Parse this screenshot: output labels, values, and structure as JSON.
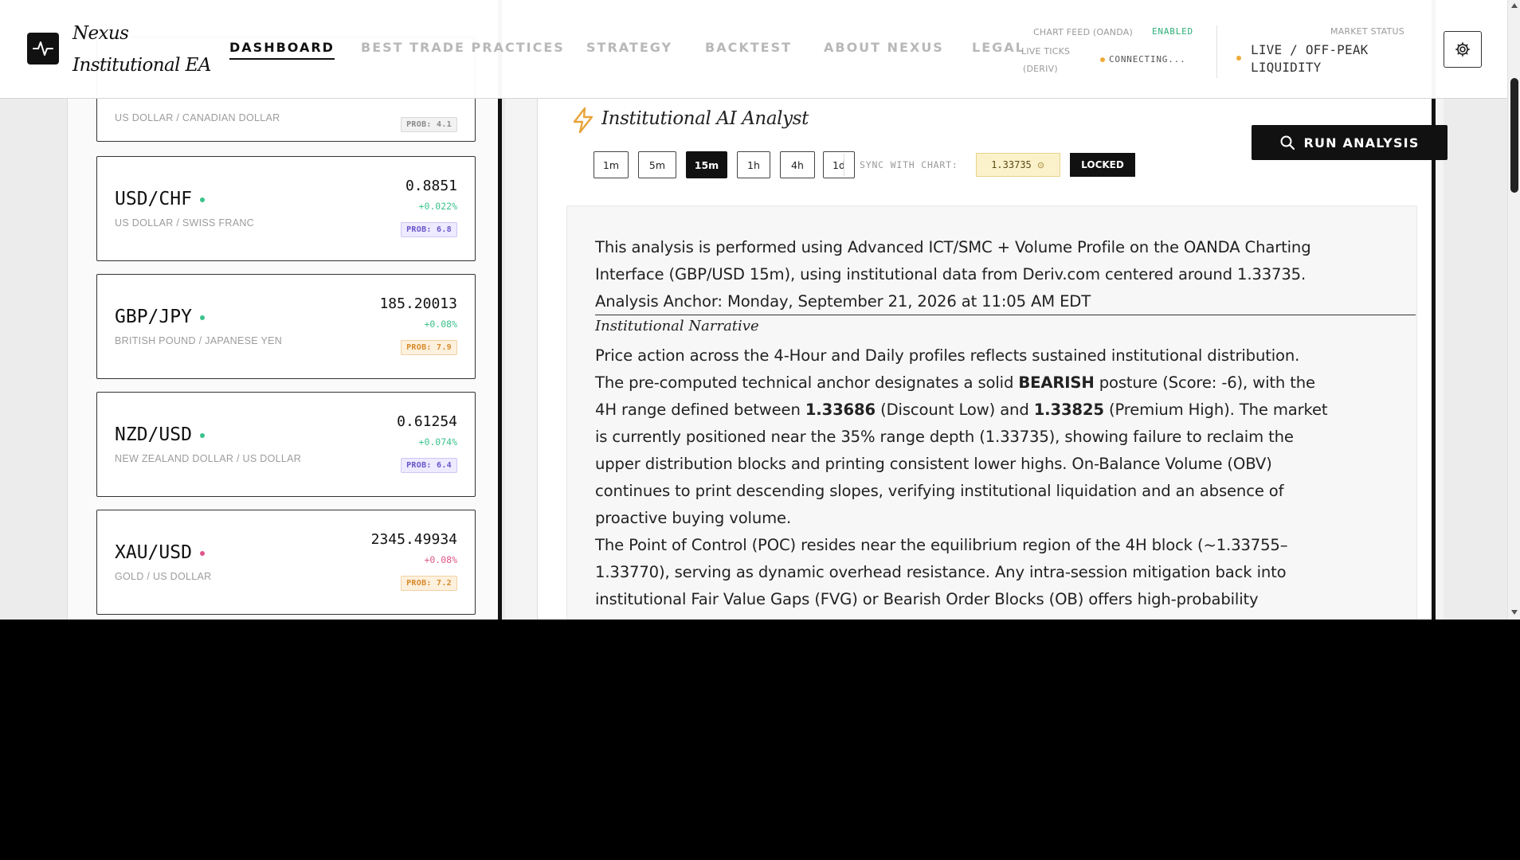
{
  "header": {
    "brand": "Nexus Institutional EA",
    "nav": [
      {
        "label": "DASHBOARD",
        "active": true
      },
      {
        "label": "BEST TRADE PRACTICES",
        "active": false
      },
      {
        "label": "STRATEGY",
        "active": false
      },
      {
        "label": "BACKTEST",
        "active": false
      },
      {
        "label": "ABOUT NEXUS",
        "active": false
      },
      {
        "label": "LEGAL",
        "active": false
      }
    ],
    "chart_feed_label": "CHART FEED (OANDA)",
    "chart_feed_status": "ENABLED",
    "live_ticks_label_1": "LIVE TICKS",
    "live_ticks_label_2": "(DERIV)",
    "live_ticks_status": "CONNECTING...",
    "market_status_label": "MARKET STATUS",
    "market_status_line1": "LIVE / OFF-PEAK",
    "market_status_line2": "LIQUIDITY",
    "status_color_enabled": "#2fae7a",
    "status_color_warn": "#f0a93a"
  },
  "pairs": [
    {
      "symbol": "",
      "name": "US DOLLAR / CANADIAN DOLLAR",
      "price": "",
      "change": "",
      "prob": "PROB: 4.1",
      "dot_color": "#3cc28c",
      "change_color": "#3cc28c",
      "prob_style": "gray"
    },
    {
      "symbol": "USD/CHF",
      "name": "US DOLLAR / SWISS FRANC",
      "price": "0.8851",
      "change": "+0.022%",
      "prob": "PROB: 6.8",
      "dot_color": "#3cc28c",
      "change_color": "#3cc28c",
      "prob_style": "purple"
    },
    {
      "symbol": "GBP/JPY",
      "name": "BRITISH POUND / JAPANESE YEN",
      "price": "185.20013",
      "change": "+0.08%",
      "prob": "PROB: 7.9",
      "dot_color": "#3cc28c",
      "change_color": "#3cc28c",
      "prob_style": "orange"
    },
    {
      "symbol": "NZD/USD",
      "name": "NEW ZEALAND DOLLAR / US DOLLAR",
      "price": "0.61254",
      "change": "+0.074%",
      "prob": "PROB: 6.4",
      "dot_color": "#3cc28c",
      "change_color": "#3cc28c",
      "prob_style": "purple"
    },
    {
      "symbol": "XAU/USD",
      "name": "GOLD / US DOLLAR",
      "price": "2345.49934",
      "change": "+0.08%",
      "prob": "PROB: 7.2",
      "dot_color": "#e0568a",
      "change_color": "#e0568a",
      "prob_style": "orange"
    }
  ],
  "analyst": {
    "title": "Institutional AI Analyst",
    "run_button": "RUN ANALYSIS",
    "timeframes": [
      {
        "label": "1m",
        "active": false
      },
      {
        "label": "5m",
        "active": false
      },
      {
        "label": "15m",
        "active": true
      },
      {
        "label": "1h",
        "active": false
      },
      {
        "label": "4h",
        "active": false
      },
      {
        "label": "1d",
        "active": false
      }
    ],
    "sync_label": "SYNC WITH CHART:",
    "sync_value": "1.33735",
    "locked_label": "LOCKED",
    "intro_line1": "This analysis is performed using Advanced ICT/SMC + Volume Profile on the OANDA Charting",
    "intro_line2": "Interface (GBP/USD 15m), using institutional data from Deriv.com centered around 1.33735.",
    "intro_line3": "Analysis Anchor: Monday, September 21, 2026 at 11:05 AM EDT",
    "narrative_title": "Institutional Narrative",
    "p1_l1": "Price action across the 4-Hour and Daily profiles reflects sustained institutional distribution.",
    "p1_l2_a": "The pre-computed technical anchor designates a solid ",
    "p1_l2_b": "BEARISH",
    "p1_l2_c": " posture (Score: -6), with the",
    "p1_l3_a": "4H range defined between ",
    "p1_l3_b": "1.33686",
    "p1_l3_c": " (Discount Low) and ",
    "p1_l3_d": "1.33825",
    "p1_l3_e": " (Premium High). The market",
    "p1_l4": "is currently positioned near the 35% range depth (1.33735), showing failure to reclaim the",
    "p1_l5": "upper distribution blocks and printing consistent lower highs. On-Balance Volume (OBV)",
    "p1_l6": "continues to print descending slopes, verifying institutional liquidation and an absence of",
    "p1_l7": "proactive buying volume.",
    "p2_l1": "The Point of Control (POC) resides near the equilibrium region of the 4H block (~1.33755–",
    "p2_l2": "1.33770), serving as dynamic overhead resistance. Any intra-session mitigation back into",
    "p2_l3": "institutional Fair Value Gaps (FVG) or Bearish Order Blocks (OB) offers high-probability"
  }
}
